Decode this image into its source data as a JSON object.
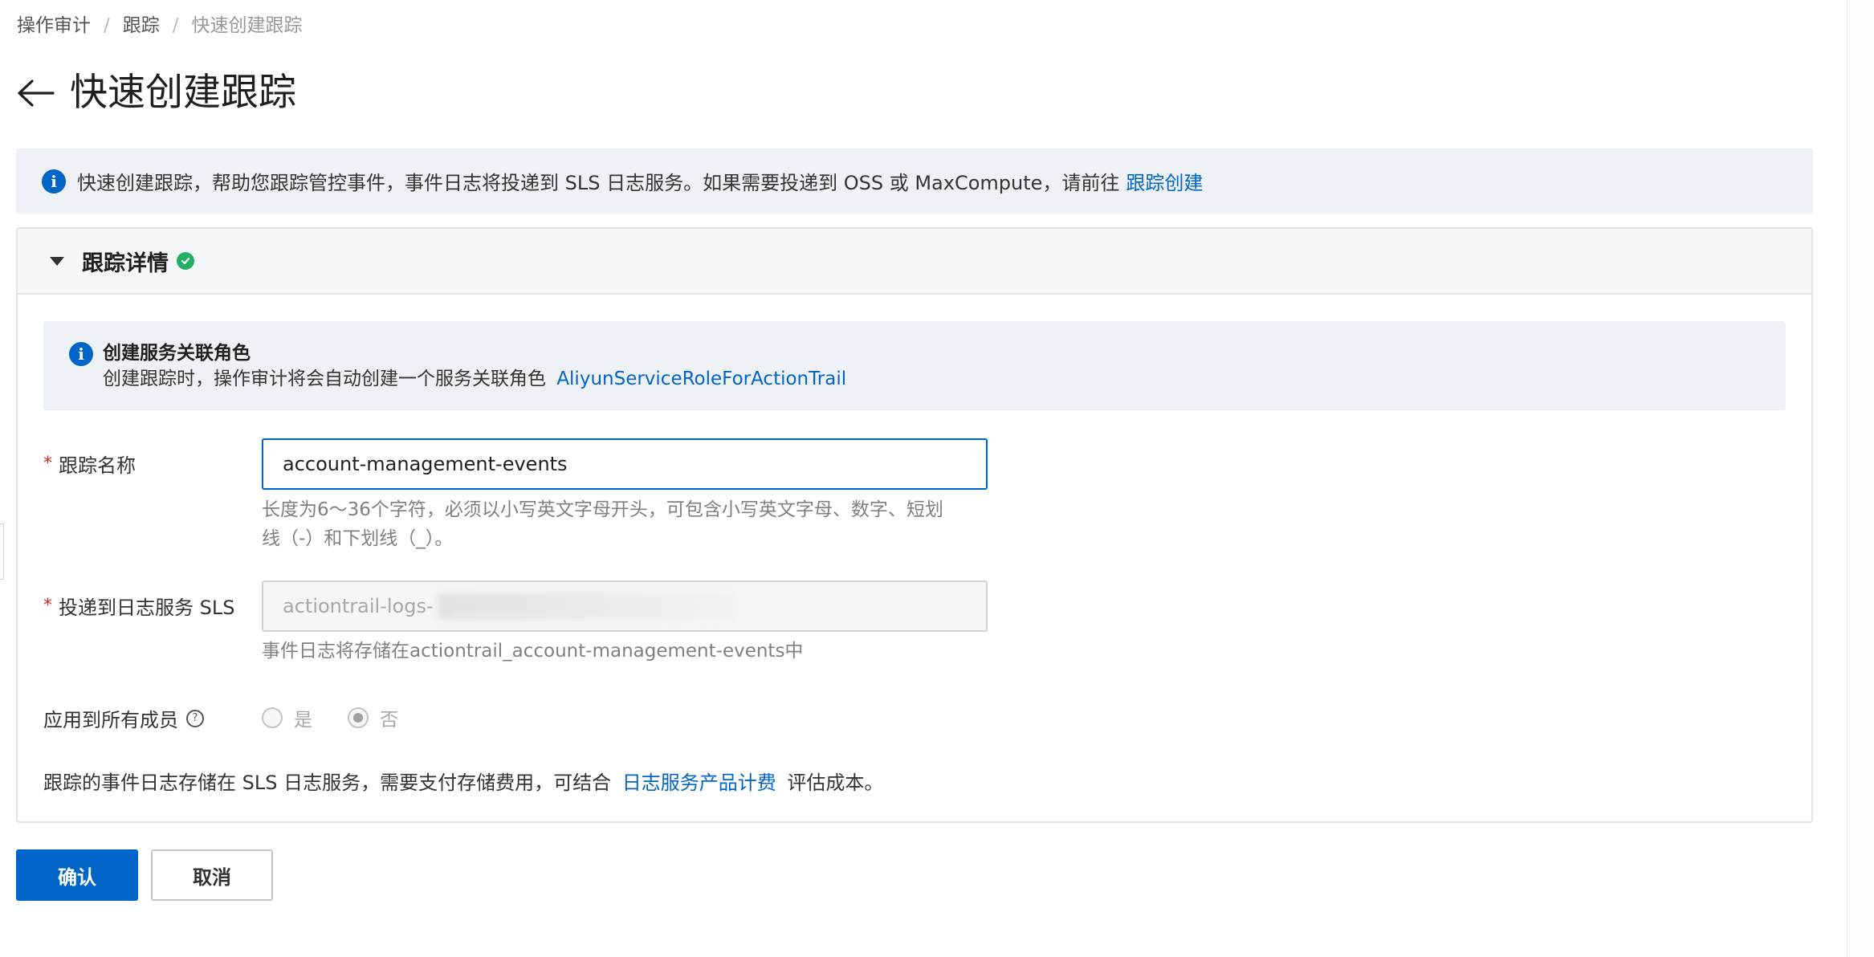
{
  "breadcrumb": {
    "items": [
      "操作审计",
      "跟踪",
      "快速创建跟踪"
    ],
    "separator": "/"
  },
  "header": {
    "title": "快速创建跟踪",
    "back_icon": "arrow-left-icon"
  },
  "top_notice": {
    "text": "快速创建跟踪，帮助您跟踪管控事件，事件日志将投递到 SLS 日志服务。如果需要投递到 OSS 或 MaxCompute，请前往",
    "link_text": "跟踪创建",
    "icon": "info-icon"
  },
  "card": {
    "title": "跟踪详情",
    "status_icon": "check-circle-icon",
    "toggle_icon": "caret-down-icon",
    "role_notice": {
      "title": "创建服务关联角色",
      "text": "创建跟踪时，操作审计将会自动创建一个服务关联角色",
      "link_text": "AliyunServiceRoleForActionTrail"
    },
    "fields": {
      "trail_name": {
        "required_mark": "*",
        "label": "跟踪名称",
        "value": "account-management-events",
        "help_line1": "长度为6～36个字符，必须以小写英文字母开头，可包含小写英文字母、数字、短划",
        "help_line2": "线（-）和下划线（_）。"
      },
      "sls_target": {
        "required_mark": "*",
        "label": "投递到日志服务 SLS",
        "value": "actiontrail-logs-",
        "help": "事件日志将存储在actiontrail_account-management-events中"
      },
      "apply_all_members": {
        "label": "应用到所有成员",
        "help_icon": "question-circle-icon",
        "help_glyph": "?",
        "options": [
          "是",
          "否"
        ],
        "selected": "否"
      }
    },
    "footer_note": {
      "text_before": "跟踪的事件日志存储在 SLS 日志服务，需要支付存储费用，可结合",
      "link_text": "日志服务产品计费",
      "text_after": "评估成本。"
    }
  },
  "actions": {
    "confirm_label": "确认",
    "cancel_label": "取消"
  },
  "colors": {
    "primary": "#0064c8",
    "notice_bg": "#eef2f6",
    "success": "#23b066",
    "required": "#d93026"
  }
}
